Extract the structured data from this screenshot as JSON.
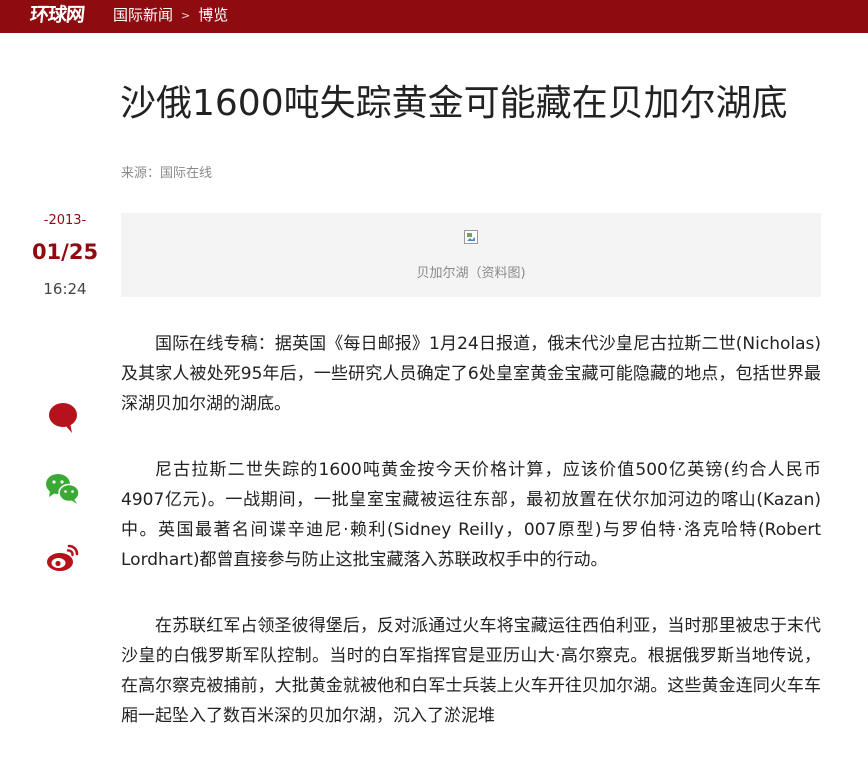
{
  "site": {
    "logo": "环球网"
  },
  "breadcrumb": {
    "items": [
      "国际新闻",
      "博览"
    ],
    "separator": ">"
  },
  "article": {
    "title": "沙俄1600吨失踪黄金可能藏在贝加尔湖底",
    "source": "来源：国际在线",
    "date": {
      "year": "-2013-",
      "day": "01/25",
      "time": "16:24"
    },
    "figure_caption": "贝加尔湖（资料图)",
    "paragraphs": [
      "国际在线专稿：据英国《每日邮报》1月24日报道，俄末代沙皇尼古拉斯二世(Nicholas)及其家人被处死95年后，一些研究人员确定了6处皇室黄金宝藏可能隐藏的地点，包括世界最深湖贝加尔湖的湖底。",
      "尼古拉斯二世失踪的1600吨黄金按今天价格计算，应该价值500亿英镑(约合人民币4907亿元)。一战期间，一批皇室宝藏被运往东部，最初放置在伏尔加河边的喀山(Kazan)中。英国最著名间谍辛迪尼·赖利(Sidney Reilly，007原型)与罗伯特·洛克哈特(Robert Lordhart)都曾直接参与防止这批宝藏落入苏联政权手中的行动。",
      "在苏联红军占领圣彼得堡后，反对派通过火车将宝藏运往西伯利亚，当时那里被忠于末代沙皇的白俄罗斯军队控制。当时的白军指挥官是亚历山大·高尔察克。根据俄罗斯当地传说，在高尔察克被捕前，大批黄金就被他和白军士兵装上火车开往贝加尔湖。这些黄金连同火车车厢一起坠入了数百米深的贝加尔湖，沉入了淤泥堆"
    ]
  },
  "share": {
    "icons": [
      "comment-icon",
      "wechat-icon",
      "weibo-icon"
    ]
  },
  "colors": {
    "brand": "#8e0b10",
    "figure_bg": "#f4f4f4",
    "share_red": "#b5121b",
    "wechat_green": "#3aaa35"
  }
}
